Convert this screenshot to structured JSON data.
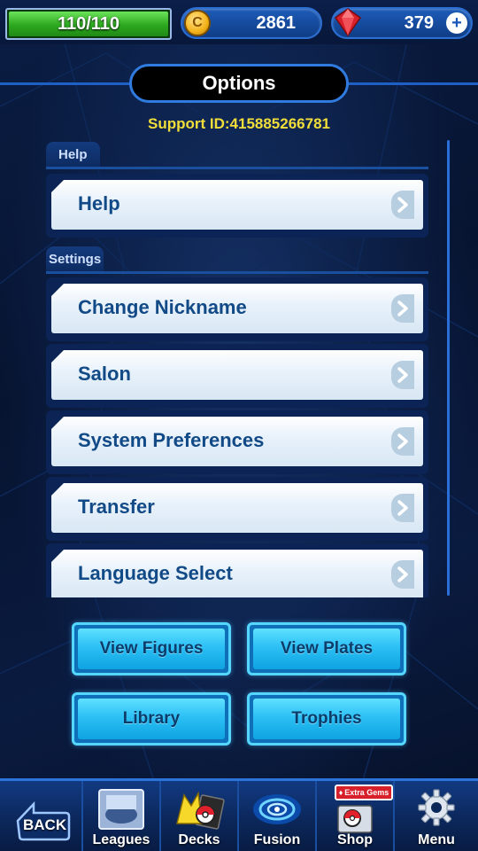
{
  "status": {
    "hp_text": "110/110",
    "hp_fraction": 1.0,
    "coins": "2861",
    "gems": "379",
    "colors": {
      "hp": "#2da81f",
      "coin": "#f3b21a",
      "gem": "#d8202a",
      "accent": "#2f7be0"
    }
  },
  "header": {
    "title": "Options",
    "support_id": "Support ID:415885266781"
  },
  "sections": {
    "help": {
      "title": "Help",
      "items": [
        {
          "label": "Help"
        }
      ]
    },
    "settings": {
      "title": "Settings",
      "items": [
        {
          "label": "Change Nickname"
        },
        {
          "label": "Salon"
        },
        {
          "label": "System Preferences"
        },
        {
          "label": "Transfer"
        },
        {
          "label": "Language Select"
        }
      ]
    }
  },
  "buttons": {
    "view_figures": "View Figures",
    "view_plates": "View Plates",
    "library": "Library",
    "trophies": "Trophies"
  },
  "nav": {
    "back": "BACK",
    "items": [
      {
        "label": "Leagues",
        "icon": "leagues-icon"
      },
      {
        "label": "Decks",
        "icon": "decks-icon"
      },
      {
        "label": "Fusion",
        "icon": "fusion-icon"
      },
      {
        "label": "Shop",
        "icon": "shop-icon",
        "badge": "Extra Gems"
      },
      {
        "label": "Menu",
        "icon": "gear-icon"
      }
    ]
  }
}
